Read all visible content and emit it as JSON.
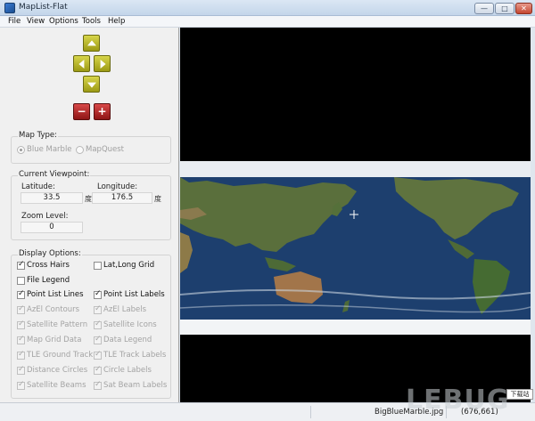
{
  "window": {
    "title": "MapList-Flat",
    "min_label": "—",
    "max_label": "□",
    "close_label": "✕"
  },
  "menu": [
    "File",
    "View",
    "Options",
    "Tools",
    "Help"
  ],
  "zoom": {
    "minus_label": "−",
    "plus_label": "+"
  },
  "map_type": {
    "title": "Map Type:",
    "options": [
      {
        "label": "Blue Marble",
        "selected": true
      },
      {
        "label": "MapQuest",
        "selected": false
      }
    ]
  },
  "viewpoint": {
    "title": "Current Viewpoint:",
    "latitude_label": "Latitude:",
    "latitude_value": "33.5",
    "latitude_unit": "度",
    "longitude_label": "Longitude:",
    "longitude_value": "176.5",
    "longitude_unit": "度",
    "zoom_label": "Zoom Level:",
    "zoom_value": "0"
  },
  "display_options": {
    "title": "Display Options:",
    "rows": [
      [
        {
          "label": "Cross Hairs",
          "checked": true,
          "enabled": true
        },
        {
          "label": "Lat,Long Grid",
          "checked": false,
          "enabled": true
        }
      ],
      [
        {
          "label": "File Legend",
          "checked": false,
          "enabled": true
        }
      ],
      [
        {
          "label": "Point List Lines",
          "checked": true,
          "enabled": true
        },
        {
          "label": "Point List Labels",
          "checked": true,
          "enabled": true
        }
      ],
      [
        {
          "label": "AzEl Contours",
          "checked": true,
          "enabled": false
        },
        {
          "label": "AzEl Labels",
          "checked": true,
          "enabled": false
        }
      ],
      [
        {
          "label": "Satellite Pattern",
          "checked": true,
          "enabled": false
        },
        {
          "label": "Satellite Icons",
          "checked": true,
          "enabled": false
        }
      ],
      [
        {
          "label": "Map Grid Data",
          "checked": true,
          "enabled": false
        },
        {
          "label": "Data Legend",
          "checked": true,
          "enabled": false
        }
      ],
      [
        {
          "label": "TLE Ground Track",
          "checked": true,
          "enabled": false
        },
        {
          "label": "TLE Track Labels",
          "checked": true,
          "enabled": false
        }
      ],
      [
        {
          "label": "Distance Circles",
          "checked": true,
          "enabled": false
        },
        {
          "label": "Circle Labels",
          "checked": true,
          "enabled": false
        }
      ],
      [
        {
          "label": "Satellite Beams",
          "checked": true,
          "enabled": false
        },
        {
          "label": "Sat Beam Labels",
          "checked": true,
          "enabled": false
        }
      ]
    ]
  },
  "status": {
    "file": "BigBlueMarble.jpg",
    "coords": "(676,661)"
  },
  "watermark": {
    "text": "LEBUG",
    "badge": "下载站"
  },
  "colors": {
    "map_background": "#000000",
    "ocean": "#1d3f6e",
    "land": "#4f6b3a",
    "ice": "#f2f4f6"
  }
}
